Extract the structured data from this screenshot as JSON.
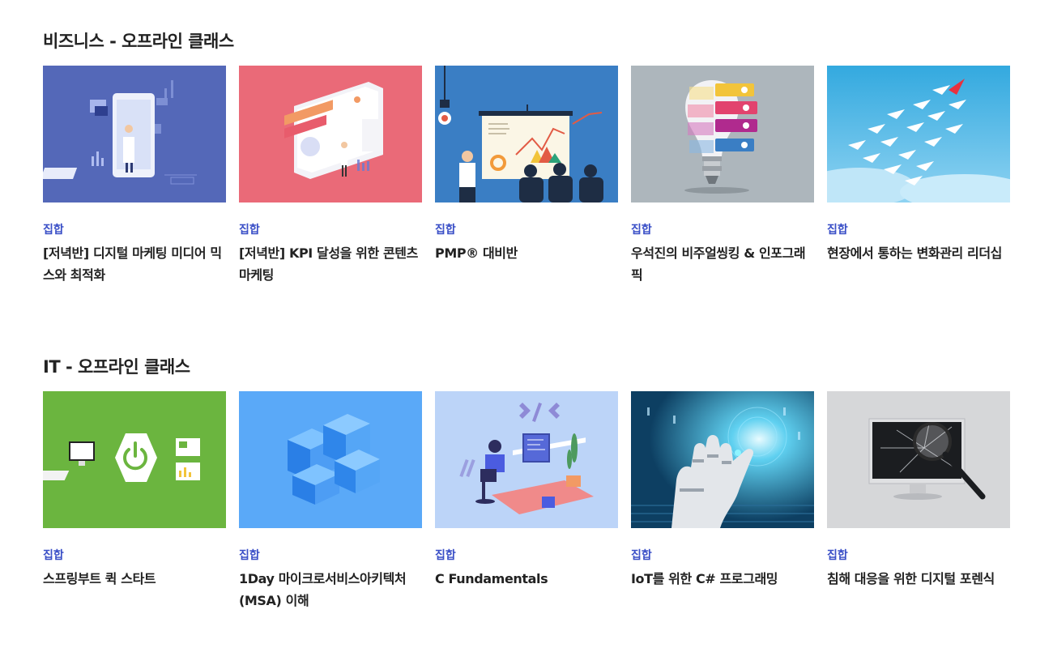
{
  "sections": [
    {
      "title": "비즈니스 - 오프라인 클래스",
      "cards": [
        {
          "tag": "집합",
          "title": "[저녁반] 디지털 마케팅 미디어 믹스와 최적화",
          "image": "digital-marketing-illustration"
        },
        {
          "tag": "집합",
          "title": "[저녁반] KPI 달성을 위한 콘텐츠 마케팅",
          "image": "content-marketing-dashboard-illustration"
        },
        {
          "tag": "집합",
          "title": "PMP® 대비반",
          "image": "presentation-board-illustration"
        },
        {
          "tag": "집합",
          "title": "우석진의 비주얼씽킹 & 인포그래픽",
          "image": "lightbulb-infographic-illustration"
        },
        {
          "tag": "집합",
          "title": "현장에서 통하는 변화관리 리더십",
          "image": "paper-planes-leader-illustration"
        }
      ]
    },
    {
      "title": "IT - 오프라인 클래스",
      "cards": [
        {
          "tag": "집합",
          "title": "스프링부트 퀵 스타트",
          "image": "spring-boot-power-illustration"
        },
        {
          "tag": "집합",
          "title": "1Day 마이크로서비스아키텍처(MSA) 이해",
          "image": "blue-cubes-illustration"
        },
        {
          "tag": "집합",
          "title": "C Fundamentals",
          "image": "developer-desk-illustration"
        },
        {
          "tag": "집합",
          "title": "IoT를 위한 C# 프로그래밍",
          "image": "robot-hand-iot-illustration"
        },
        {
          "tag": "집합",
          "title": "침해 대응을 위한 디지털 포렌식",
          "image": "broken-monitor-forensics-illustration"
        }
      ]
    }
  ]
}
